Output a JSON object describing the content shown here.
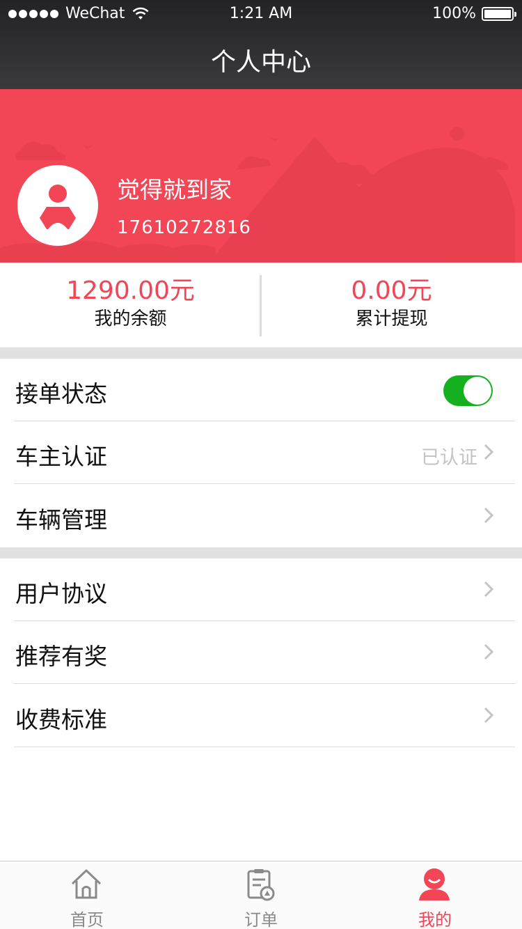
{
  "status_bar": {
    "carrier": "WeChat",
    "time": "1:21 AM",
    "battery": "100%"
  },
  "nav": {
    "title": "个人中心"
  },
  "profile": {
    "name": "觉得就到家",
    "phone": "17610272816"
  },
  "stats": [
    {
      "value": "1290.00元",
      "label": "我的余额"
    },
    {
      "value": "0.00元",
      "label": "累计提现"
    }
  ],
  "menu": {
    "order_status": {
      "label": "接单状态",
      "toggle_on": true
    },
    "owner_cert": {
      "label": "车主认证",
      "status": "已认证"
    },
    "vehicle_mgmt": {
      "label": "车辆管理"
    },
    "user_agreement": {
      "label": "用户协议"
    },
    "referral": {
      "label": "推荐有奖"
    },
    "fees": {
      "label": "收费标准"
    }
  },
  "tabs": [
    {
      "label": "首页",
      "icon": "home-icon",
      "active": false
    },
    {
      "label": "订单",
      "icon": "orders-icon",
      "active": false
    },
    {
      "label": "我的",
      "icon": "profile-icon",
      "active": true
    }
  ],
  "colors": {
    "accent": "#f24556",
    "toggle_on": "#14b01f",
    "nav_bg": "#2e2e30"
  }
}
